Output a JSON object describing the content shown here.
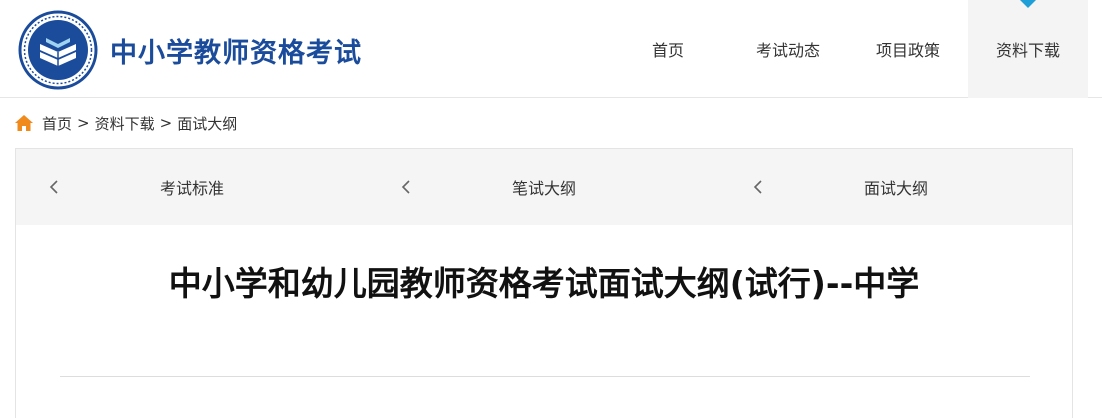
{
  "header": {
    "site_title": "中小学教师资格考试",
    "nav": [
      {
        "label": "首页",
        "active": false
      },
      {
        "label": "考试动态",
        "active": false
      },
      {
        "label": "项目政策",
        "active": false
      },
      {
        "label": "资料下载",
        "active": true
      }
    ]
  },
  "breadcrumb": {
    "items": [
      "首页",
      "资料下载",
      "面试大纲"
    ],
    "separator": ">"
  },
  "subnav": {
    "items": [
      "考试标准",
      "笔试大纲",
      "面试大纲"
    ]
  },
  "article": {
    "title": "中小学和幼儿园教师资格考试面试大纲(试行)--中学"
  },
  "colors": {
    "brand": "#1b4c9c",
    "accent": "#1e9fd8",
    "home_icon": "#f08a1c"
  },
  "icons": {
    "logo": "book-emblem-logo",
    "home": "home-icon",
    "subnav_prev": "chevron-left-icon",
    "nav_active": "caret-down-icon"
  }
}
